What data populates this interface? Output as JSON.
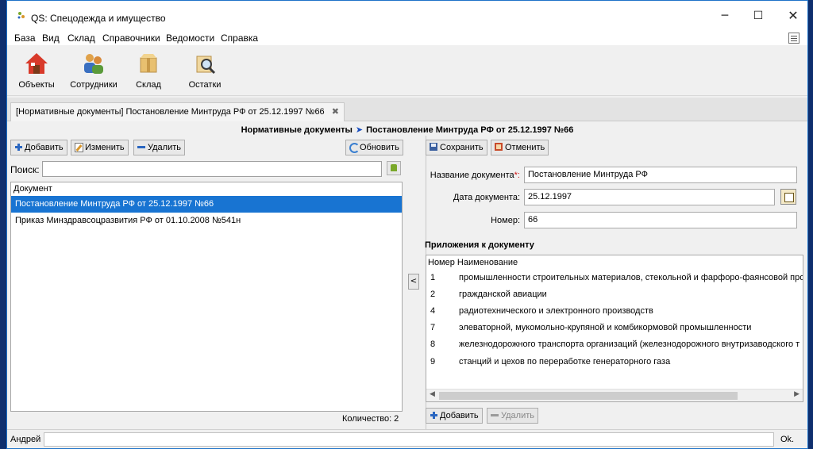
{
  "window": {
    "title": "QS: Спецодежда и имущество"
  },
  "menu": {
    "items": [
      "База",
      "Вид",
      "Склад",
      "Справочники",
      "Ведомости",
      "Справка"
    ]
  },
  "toolbar": {
    "buttons": [
      "Объекты",
      "Сотрудники",
      "Склад",
      "Остатки"
    ]
  },
  "tab": {
    "label": "[Нормативные документы] Постановление Минтруда РФ от 25.12.1997 №66"
  },
  "breadcrumb": {
    "section": "Нормативные документы",
    "current": "Постановление Минтруда РФ от 25.12.1997 №66"
  },
  "left": {
    "add_label": "Добавить",
    "edit_label": "Изменить",
    "delete_label": "Удалить",
    "refresh_label": "Обновить",
    "search_label": "Поиск:",
    "search_value": "",
    "column_header": "Документ",
    "rows": [
      "Постановление Минтруда РФ от 25.12.1997 №66",
      "Приказ Минздравсоцразвития РФ от 01.10.2008 №541н"
    ],
    "count_label": "Количество: 2"
  },
  "splitter": {
    "label": "<"
  },
  "right": {
    "save_label": "Сохранить",
    "cancel_label": "Отменить",
    "name_label": "Название документа",
    "name_required_mark": "*:",
    "name_value": "Постановление Минтруда РФ",
    "date_label": "Дата документа:",
    "date_value": "25.12.1997",
    "number_label": "Номер:",
    "number_value": "66",
    "attachments_title": "Приложения к документу",
    "attachments_header": {
      "num": "Номер",
      "name": "Наименование"
    },
    "attachments": [
      {
        "num": "1",
        "name": "промышленности строительных материалов, стекольной и фарфоро-фаянсовой про"
      },
      {
        "num": "2",
        "name": "гражданской авиации"
      },
      {
        "num": "4",
        "name": "радиотехнического и электронного производств"
      },
      {
        "num": "7",
        "name": "элеваторной, мукомольно-крупяной и комбикормовой промышленности"
      },
      {
        "num": "8",
        "name": "железнодорожного транспорта организаций (железнодорожного внутризаводского т"
      },
      {
        "num": "9",
        "name": "станций и цехов по переработке генераторного газа"
      }
    ],
    "attach_add_label": "Добавить",
    "attach_delete_label": "Удалить"
  },
  "status": {
    "user": "Андрей",
    "state": "Ok."
  },
  "colors": {
    "selection": "#1874d2",
    "breadcrumb_arrow": "#1a4fc0",
    "required": "#d01010"
  }
}
